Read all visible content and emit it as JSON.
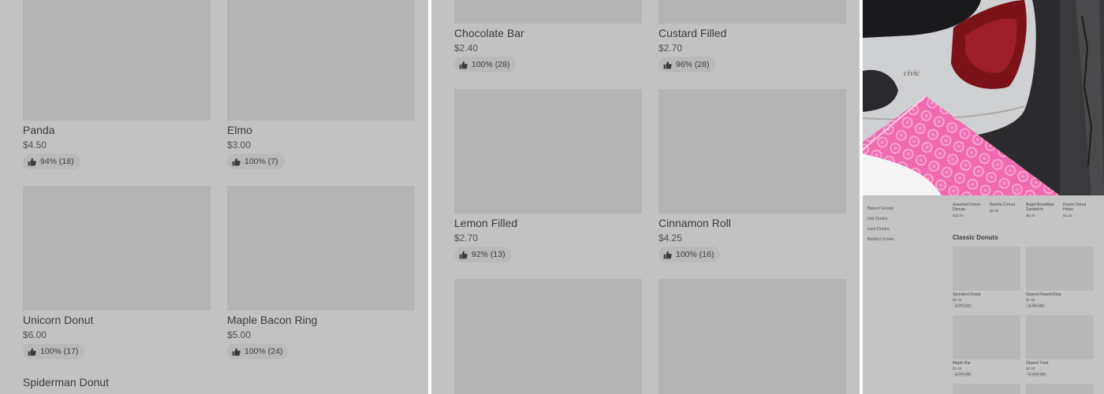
{
  "colors": {
    "overlay": "#c2c2c2",
    "thumb": "#b4b4b4",
    "pill": "#b9b9b9",
    "photo_pink": "#f06ab0"
  },
  "icons": {
    "rating": "thumbs-up-icon"
  },
  "panel1": {
    "items": [
      {
        "name": "Panda",
        "price": "$4.50",
        "rating": "94% (18)"
      },
      {
        "name": "Elmo",
        "price": "$3.00",
        "rating": "100% (7)"
      },
      {
        "name": "Unicorn Donut",
        "price": "$6.00",
        "rating": "100% (17)"
      },
      {
        "name": "Maple Bacon Ring",
        "price": "$5.00",
        "rating": "100% (24)"
      },
      {
        "name": "Spiderman Donut"
      }
    ]
  },
  "panel2": {
    "items": [
      {
        "name": "Chocolate Bar",
        "price": "$2.40",
        "rating": "100% (28)"
      },
      {
        "name": "Custard Filled",
        "price": "$2.70",
        "rating": "96% (28)"
      },
      {
        "name": "Lemon Filled",
        "price": "$2.70",
        "rating": "92% (13)"
      },
      {
        "name": "Cinnamon Roll",
        "price": "$4.25",
        "rating": "100% (16)"
      }
    ]
  },
  "panel3": {
    "sidebar": [
      "Baked Goods",
      "Hot Drinks",
      "Iced Drinks",
      "Bottled Drinks"
    ],
    "top_items": [
      {
        "name": "Assorted Dozen Donuts",
        "price": "$20.00"
      },
      {
        "name": "Nutella Cronut",
        "price": "$6.50"
      },
      {
        "name": "Bagel Breakfast Sandwich",
        "price": "$8.00"
      },
      {
        "name": "Dozen Donut Holes",
        "price": "$4.25"
      }
    ],
    "section_title": "Classic Donuts",
    "items": [
      {
        "name": "Sprinkled Donut",
        "price": "$2.40",
        "rating": "97% (37)"
      },
      {
        "name": "Glazed Raised Ring",
        "price": "$1.95",
        "rating": "98% (36)"
      },
      {
        "name": "Maple Bar",
        "price": "$2.40",
        "rating": "97% (38)"
      },
      {
        "name": "Glazed Twist",
        "price": "$2.40",
        "rating": "100% (24)"
      }
    ]
  }
}
